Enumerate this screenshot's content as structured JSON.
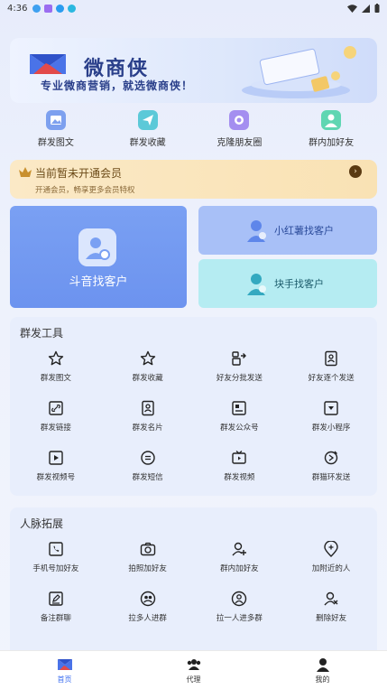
{
  "status_bar": {
    "time": "4:36"
  },
  "banner": {
    "brand": "微商侠",
    "tagline": "专业微商营销，就选微商侠！"
  },
  "quick_actions": [
    {
      "label": "群发图文",
      "icon": "image-icon",
      "color": "#7da0ef"
    },
    {
      "label": "群发收藏",
      "icon": "send-icon",
      "color": "#5cc9d8"
    },
    {
      "label": "克隆朋友圈",
      "icon": "camera-icon",
      "color": "#a48ef0"
    },
    {
      "label": "群内加好友",
      "icon": "user-icon",
      "color": "#5fd6b2"
    }
  ],
  "vip": {
    "title": "当前暂未开通会员",
    "subtitle": "开通会员，畅享更多会员特权"
  },
  "douyin": {
    "label": "斗音找客户"
  },
  "xiaohongshu": {
    "label": "小红薯找客户"
  },
  "kuaishou": {
    "label": "块手找客户"
  },
  "tools": {
    "title": "群发工具",
    "items": [
      {
        "label": "群发图文",
        "icon": "star-icon"
      },
      {
        "label": "群发收藏",
        "icon": "star-outline-icon"
      },
      {
        "label": "好友分批发送",
        "icon": "batch-send-icon"
      },
      {
        "label": "好友逐个发送",
        "icon": "contact-card-icon"
      },
      {
        "label": "群发链接",
        "icon": "link-icon"
      },
      {
        "label": "群发名片",
        "icon": "name-card-icon"
      },
      {
        "label": "群发公众号",
        "icon": "official-account-icon"
      },
      {
        "label": "群发小程序",
        "icon": "mini-program-icon"
      },
      {
        "label": "群发视频号",
        "icon": "video-channel-icon"
      },
      {
        "label": "群发短信",
        "icon": "message-icon"
      },
      {
        "label": "群发视频",
        "icon": "tv-icon"
      },
      {
        "label": "群猫环发送",
        "icon": "loop-send-icon"
      }
    ]
  },
  "network": {
    "title": "人脉拓展",
    "items": [
      {
        "label": "手机号加好友",
        "icon": "phone-icon"
      },
      {
        "label": "拍照加好友",
        "icon": "camera-outline-icon"
      },
      {
        "label": "群内加好友",
        "icon": "add-user-icon"
      },
      {
        "label": "加附近的人",
        "icon": "location-add-icon"
      },
      {
        "label": "备注群聊",
        "icon": "edit-icon"
      },
      {
        "label": "拉多人进群",
        "icon": "group-icon"
      },
      {
        "label": "拉一人进多群",
        "icon": "person-circle-icon"
      },
      {
        "label": "删除好友",
        "icon": "remove-user-icon"
      }
    ]
  },
  "tabbar": [
    {
      "label": "首页",
      "icon": "home-icon",
      "active": true
    },
    {
      "label": "代理",
      "icon": "agent-icon",
      "active": false
    },
    {
      "label": "我的",
      "icon": "profile-icon",
      "active": false
    }
  ],
  "colors": {
    "accent": "#3b6df0",
    "douyin": "#6c93ef",
    "xhs": "#a8c0f7",
    "ks": "#b5ecf2",
    "vip": "#f9e2b4"
  }
}
